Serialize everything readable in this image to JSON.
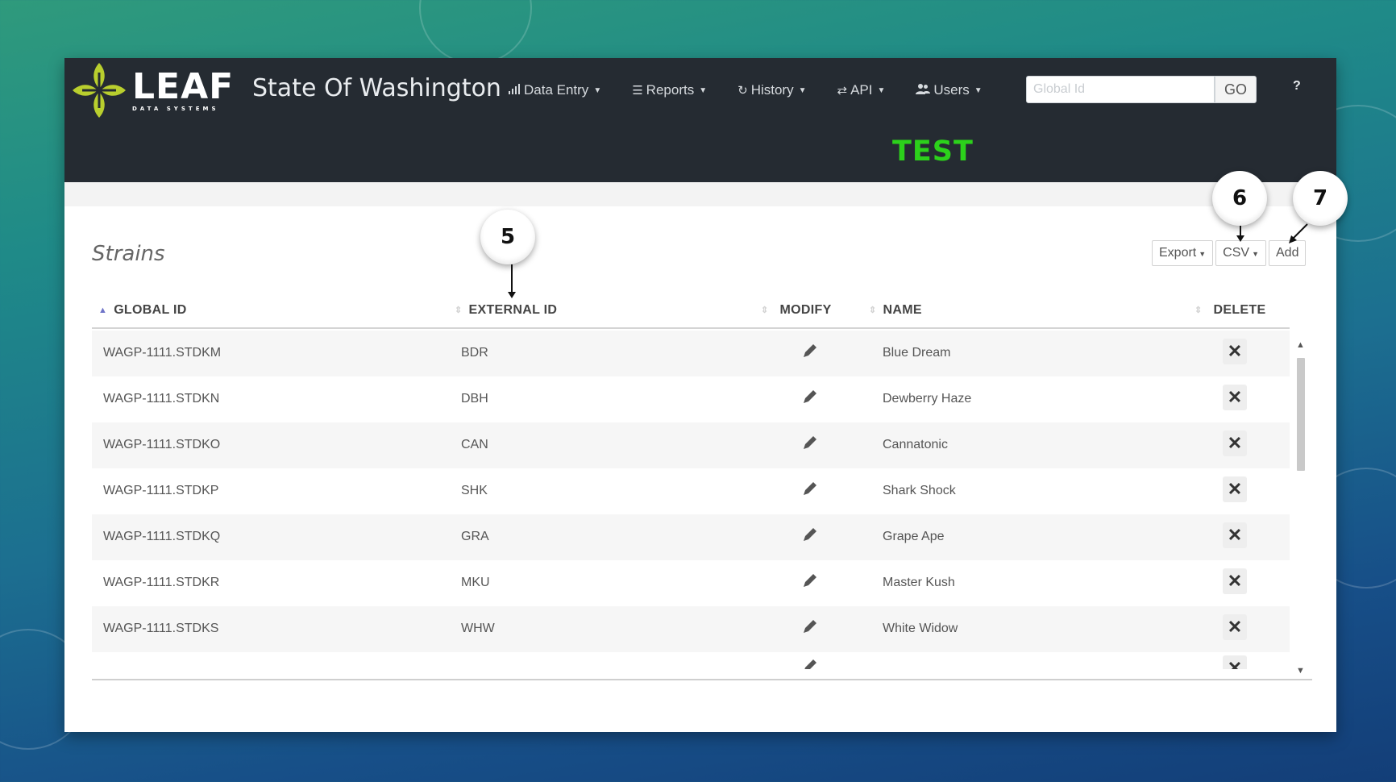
{
  "brand": {
    "logo_word": "LEAF",
    "logo_sub": "DATA SYSTEMS",
    "title": "State Of Washington"
  },
  "nav": {
    "items": [
      {
        "label": "Data Entry",
        "icon": "bar-chart-icon"
      },
      {
        "label": "Reports",
        "icon": "list-icon"
      },
      {
        "label": "History",
        "icon": "refresh-icon"
      },
      {
        "label": "API",
        "icon": "exchange-icon"
      },
      {
        "label": "Users",
        "icon": "users-icon"
      }
    ],
    "search_placeholder": "Global Id",
    "go_label": "GO",
    "help_label": "?"
  },
  "env_label": "TEST",
  "page": {
    "heading": "Strains",
    "buttons": {
      "export": "Export",
      "csv": "CSV",
      "add": "Add"
    }
  },
  "table": {
    "columns": [
      "GLOBAL ID",
      "EXTERNAL ID",
      "MODIFY",
      "NAME",
      "DELETE"
    ],
    "rows": [
      {
        "global_id": "WAGP-1111.STDKM",
        "external_id": "BDR",
        "name": "Blue Dream"
      },
      {
        "global_id": "WAGP-1111.STDKN",
        "external_id": "DBH",
        "name": "Dewberry Haze"
      },
      {
        "global_id": "WAGP-1111.STDKO",
        "external_id": "CAN",
        "name": "Cannatonic"
      },
      {
        "global_id": "WAGP-1111.STDKP",
        "external_id": "SHK",
        "name": "Shark Shock"
      },
      {
        "global_id": "WAGP-1111.STDKQ",
        "external_id": "GRA",
        "name": "Grape Ape"
      },
      {
        "global_id": "WAGP-1111.STDKR",
        "external_id": "MKU",
        "name": "Master Kush"
      },
      {
        "global_id": "WAGP-1111.STDKS",
        "external_id": "WHW",
        "name": "White Widow"
      }
    ]
  },
  "callouts": [
    "5",
    "6",
    "7"
  ],
  "colors": {
    "navbar": "#252b32",
    "test": "#2cd11b",
    "sort_active": "#6f74c8"
  }
}
